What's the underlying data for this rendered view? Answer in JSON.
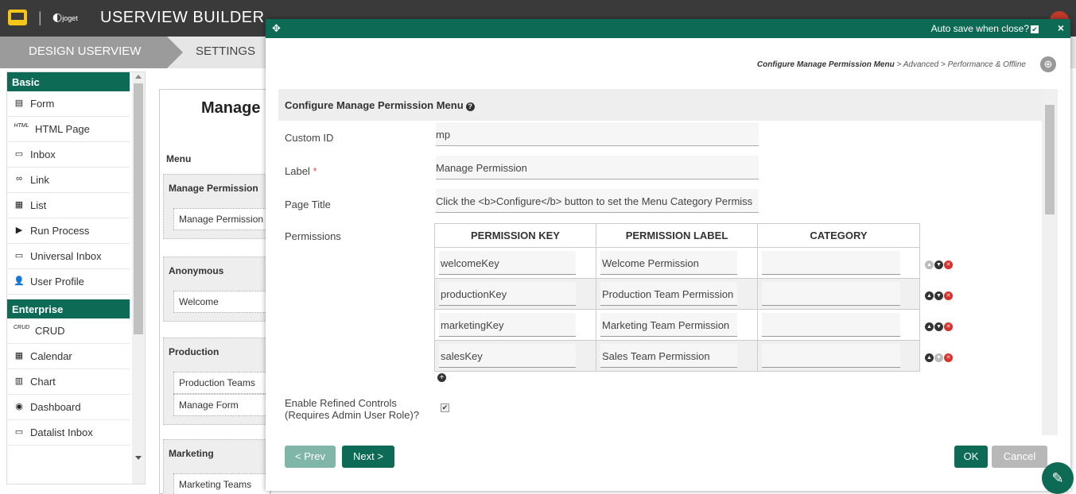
{
  "app": {
    "title": "USERVIEW BUILDER",
    "brand": "joget",
    "separator": "|"
  },
  "tabs": {
    "design": "DESIGN USERVIEW",
    "settings": "SETTINGS"
  },
  "palette": {
    "basic_header": "Basic",
    "basic_items": [
      {
        "label": "Form",
        "icon": "form-icon",
        "glyph": "▤"
      },
      {
        "label": "HTML Page",
        "icon": "html-icon",
        "glyph": "HTML"
      },
      {
        "label": "Inbox",
        "icon": "inbox-icon",
        "glyph": "▭"
      },
      {
        "label": "Link",
        "icon": "link-icon",
        "glyph": "∞"
      },
      {
        "label": "List",
        "icon": "list-icon",
        "glyph": "▦"
      },
      {
        "label": "Run Process",
        "icon": "play-icon",
        "glyph": "▶"
      },
      {
        "label": "Universal Inbox",
        "icon": "inbox-icon",
        "glyph": "▭"
      },
      {
        "label": "User Profile",
        "icon": "user-icon",
        "glyph": "👤"
      }
    ],
    "enterprise_header": "Enterprise",
    "enterprise_items": [
      {
        "label": "CRUD",
        "icon": "crud-icon",
        "glyph": "CRUD"
      },
      {
        "label": "Calendar",
        "icon": "calendar-icon",
        "glyph": "▦"
      },
      {
        "label": "Chart",
        "icon": "chart-icon",
        "glyph": "▥"
      },
      {
        "label": "Dashboard",
        "icon": "dashboard-icon",
        "glyph": "◉"
      },
      {
        "label": "Datalist Inbox",
        "icon": "inbox-icon",
        "glyph": "▭"
      }
    ]
  },
  "canvas": {
    "title": "Manage",
    "menu_label": "Menu",
    "categories": [
      {
        "title": "Manage Permission",
        "items": [
          "Manage Permission"
        ]
      },
      {
        "title": "Anonymous",
        "items": [
          "Welcome"
        ]
      },
      {
        "title": "Production",
        "items": [
          "Production Teams",
          "Manage Form"
        ]
      },
      {
        "title": "Marketing",
        "items": [
          "Marketing Teams"
        ]
      }
    ]
  },
  "modal": {
    "autosave_label": "Auto save when close?",
    "autosave_checked": "✔",
    "close_glyph": "×",
    "breadcrumb": {
      "current": "Configure Manage Permission Menu",
      "rest": " > Advanced > Performance & Offline"
    },
    "panel_title": "Configure Manage Permission Menu",
    "help_glyph": "?",
    "fields": {
      "custom_id_label": "Custom ID",
      "custom_id_value": "mp",
      "label_label": "Label",
      "label_required": "*",
      "label_value": "Manage Permission",
      "page_title_label": "Page Title",
      "page_title_value": "Click the <b>Configure</b> button to set the Menu Category Permiss",
      "permissions_label": "Permissions",
      "refined_label_line1": "Enable Refined Controls",
      "refined_label_line2": "(Requires Admin User Role)?",
      "refined_checked": "✔"
    },
    "permissions_table": {
      "headers": [
        "PERMISSION KEY",
        "PERMISSION LABEL",
        "CATEGORY"
      ],
      "rows": [
        {
          "key": "welcomeKey",
          "label": "Welcome Permission",
          "category": ""
        },
        {
          "key": "productionKey",
          "label": "Production Team Permission",
          "category": ""
        },
        {
          "key": "marketingKey",
          "label": "Marketing Team Permission",
          "category": ""
        },
        {
          "key": "salesKey",
          "label": "Sales Team Permission",
          "category": ""
        }
      ]
    },
    "buttons": {
      "prev": "< Prev",
      "next": "Next >",
      "ok": "OK",
      "cancel": "Cancel"
    }
  },
  "colors": {
    "primary": "#0d6b55",
    "danger": "#d9302c",
    "topbar": "#3a3a3a"
  }
}
